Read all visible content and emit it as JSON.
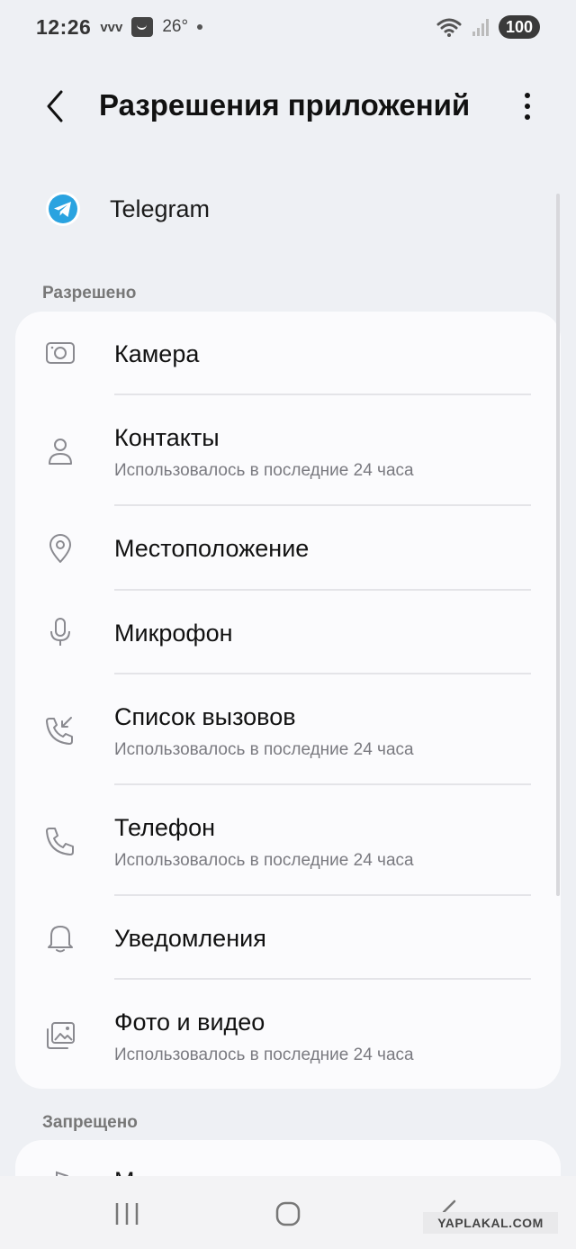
{
  "status_bar": {
    "time": "12:26",
    "indicator": "vvv",
    "temperature": "26°",
    "battery": "100"
  },
  "header": {
    "title": "Разрешения приложений"
  },
  "app": {
    "name": "Telegram",
    "icon": "telegram-icon",
    "icon_color": "#2aa3e0"
  },
  "allowed": {
    "label": "Разрешено",
    "items": [
      {
        "title": "Камера",
        "subtitle": "",
        "icon": "camera-icon"
      },
      {
        "title": "Контакты",
        "subtitle": "Использовалось в последние 24 часа",
        "icon": "person-icon"
      },
      {
        "title": "Местоположение",
        "subtitle": "",
        "icon": "location-pin-icon"
      },
      {
        "title": "Микрофон",
        "subtitle": "",
        "icon": "microphone-icon"
      },
      {
        "title": "Список вызовов",
        "subtitle": "Использовалось в последние 24 часа",
        "icon": "call-log-icon"
      },
      {
        "title": "Телефон",
        "subtitle": "Использовалось в последние 24 часа",
        "icon": "phone-icon"
      },
      {
        "title": "Уведомления",
        "subtitle": "",
        "icon": "bell-icon"
      },
      {
        "title": "Фото и видео",
        "subtitle": "Использовалось в последние 24 часа",
        "icon": "photos-icon"
      }
    ]
  },
  "denied": {
    "label": "Запрещено",
    "first_item_partial": "М"
  },
  "watermark": "YAPLAKAL.COM",
  "colors": {
    "background": "#eef0f4",
    "card": "#fbfbfd",
    "icon_gray": "#8a8a90"
  }
}
